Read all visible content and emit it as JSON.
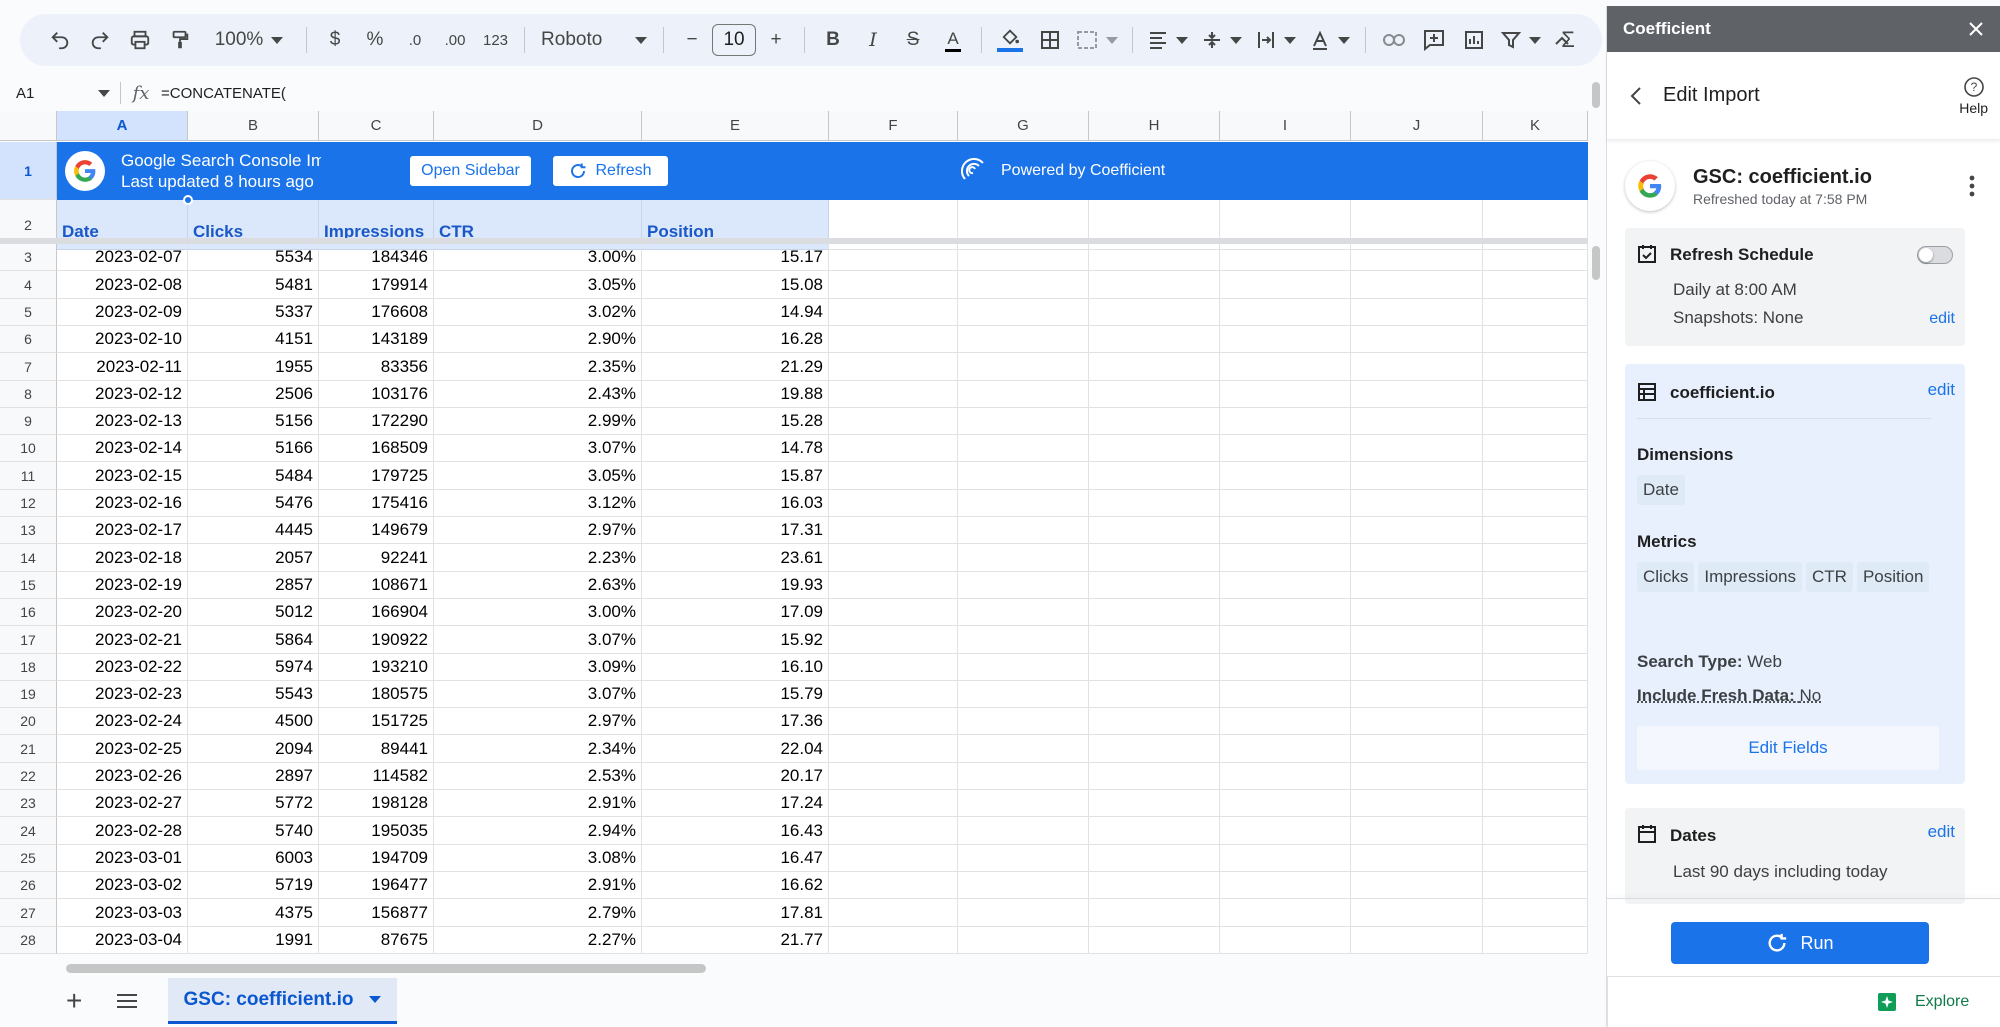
{
  "toolbar": {
    "zoom": "100%",
    "currency": "$",
    "percent": "%",
    "decrease_decimal": ".0",
    "increase_decimal": ".00",
    "number_format": "123",
    "font": "Roboto",
    "font_size": "10",
    "text_color_letter": "A",
    "fill_color": "#1a73e8"
  },
  "formula_bar": {
    "cell_ref": "A1",
    "formula": "=CONCATENATE("
  },
  "columns": [
    "A",
    "B",
    "C",
    "D",
    "E",
    "F",
    "G",
    "H",
    "I",
    "J",
    "K"
  ],
  "banner": {
    "title": "Google Search Console Im",
    "subtitle": "Last updated 8 hours ago",
    "open_sidebar": "Open Sidebar",
    "refresh": "Refresh",
    "powered_by": "Powered by Coefficient"
  },
  "table": {
    "headers": [
      "Date",
      "Clicks",
      "Impressions",
      "CTR",
      "Position"
    ],
    "rows": [
      [
        "2023-02-07",
        "5534",
        "184346",
        "3.00%",
        "15.17"
      ],
      [
        "2023-02-08",
        "5481",
        "179914",
        "3.05%",
        "15.08"
      ],
      [
        "2023-02-09",
        "5337",
        "176608",
        "3.02%",
        "14.94"
      ],
      [
        "2023-02-10",
        "4151",
        "143189",
        "2.90%",
        "16.28"
      ],
      [
        "2023-02-11",
        "1955",
        "83356",
        "2.35%",
        "21.29"
      ],
      [
        "2023-02-12",
        "2506",
        "103176",
        "2.43%",
        "19.88"
      ],
      [
        "2023-02-13",
        "5156",
        "172290",
        "2.99%",
        "15.28"
      ],
      [
        "2023-02-14",
        "5166",
        "168509",
        "3.07%",
        "14.78"
      ],
      [
        "2023-02-15",
        "5484",
        "179725",
        "3.05%",
        "15.87"
      ],
      [
        "2023-02-16",
        "5476",
        "175416",
        "3.12%",
        "16.03"
      ],
      [
        "2023-02-17",
        "4445",
        "149679",
        "2.97%",
        "17.31"
      ],
      [
        "2023-02-18",
        "2057",
        "92241",
        "2.23%",
        "23.61"
      ],
      [
        "2023-02-19",
        "2857",
        "108671",
        "2.63%",
        "19.93"
      ],
      [
        "2023-02-20",
        "5012",
        "166904",
        "3.00%",
        "17.09"
      ],
      [
        "2023-02-21",
        "5864",
        "190922",
        "3.07%",
        "15.92"
      ],
      [
        "2023-02-22",
        "5974",
        "193210",
        "3.09%",
        "16.10"
      ],
      [
        "2023-02-23",
        "5543",
        "180575",
        "3.07%",
        "15.79"
      ],
      [
        "2023-02-24",
        "4500",
        "151725",
        "2.97%",
        "17.36"
      ],
      [
        "2023-02-25",
        "2094",
        "89441",
        "2.34%",
        "22.04"
      ],
      [
        "2023-02-26",
        "2897",
        "114582",
        "2.53%",
        "20.17"
      ],
      [
        "2023-02-27",
        "5772",
        "198128",
        "2.91%",
        "17.24"
      ],
      [
        "2023-02-28",
        "5740",
        "195035",
        "2.94%",
        "16.43"
      ],
      [
        "2023-03-01",
        "6003",
        "194709",
        "3.08%",
        "16.47"
      ],
      [
        "2023-03-02",
        "5719",
        "196477",
        "2.91%",
        "16.62"
      ],
      [
        "2023-03-03",
        "4375",
        "156877",
        "2.79%",
        "17.81"
      ],
      [
        "2023-03-04",
        "1991",
        "87675",
        "2.27%",
        "21.77"
      ]
    ]
  },
  "sheet": {
    "tab_name": "GSC: coefficient.io",
    "explore": "Explore"
  },
  "panel": {
    "app_title": "Coefficient",
    "page_title": "Edit Import",
    "help": "Help",
    "import_name": "GSC: coefficient.io",
    "refreshed": "Refreshed today at 7:58 PM",
    "schedule": {
      "title": "Refresh Schedule",
      "time": "Daily at 8:00 AM",
      "snapshots": "Snapshots: None",
      "edit": "edit",
      "enabled": false
    },
    "source": {
      "name": "coefficient.io",
      "edit": "edit",
      "dimensions_label": "Dimensions",
      "dimensions": [
        "Date"
      ],
      "metrics_label": "Metrics",
      "metrics": [
        "Clicks",
        "Impressions",
        "CTR",
        "Position"
      ],
      "search_type_label": "Search Type:",
      "search_type": "Web",
      "fresh_label": "Include Fresh Data:",
      "fresh": "No",
      "edit_fields": "Edit Fields"
    },
    "dates": {
      "title": "Dates",
      "edit": "edit",
      "value": "Last 90 days including today"
    },
    "run": "Run"
  }
}
